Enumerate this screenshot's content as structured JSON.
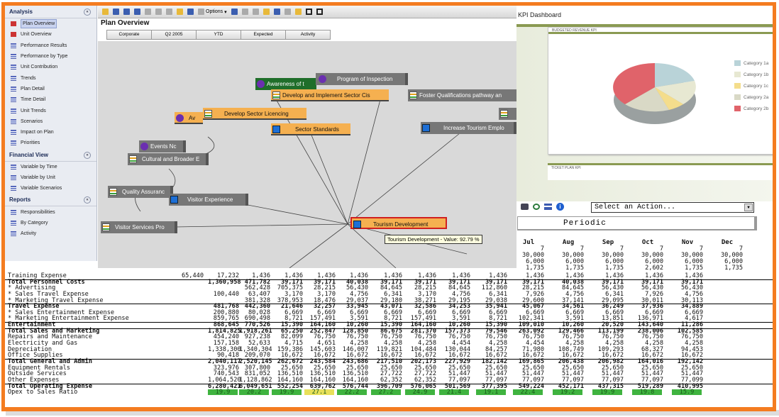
{
  "left_panel": {
    "sections": [
      {
        "title": "Analysis",
        "items": [
          "Plan Overview",
          "Unit Overview",
          "Performance Results",
          "Performance by Type",
          "Unit Contribution",
          "Trends",
          "Plan Detail",
          "Time Detail",
          "Unit Trends",
          "Scenarios",
          "Impact on Plan",
          "Priorities"
        ]
      },
      {
        "title": "Financial View",
        "items": [
          "Variable by Time",
          "Variable by Unit",
          "Variable Scenarios"
        ]
      },
      {
        "title": "Reports",
        "items": [
          "Responsibilities",
          "By Category",
          "Activity"
        ]
      }
    ]
  },
  "plan": {
    "toolbar_options": "Options",
    "title": "Plan Overview",
    "tabs": [
      "Corporate",
      "Q2 2005",
      "YTD",
      "Expected",
      "Activity"
    ],
    "nodes": {
      "awareness": "Awareness of t",
      "program": "Program of Inspection",
      "develop_implement": "Develop and Implement Sector Cis",
      "foster": "Foster Qualifications pathway an",
      "av": "Av",
      "licencing": "Develop Sector Licencing",
      "standards": "Sector Standards",
      "increase": "Increase Tourism Emplo",
      "events": "Events Nc",
      "cultural": "Cultural and Broader E",
      "quality": "Quality Assuranc",
      "visitor_exp": "Visitor Experience",
      "visitor_svc": "Visitor Services Pro",
      "tourism_dev": "Tourism Development"
    },
    "tooltip": "Tourism Development - Value: 92.79 %"
  },
  "kpi": {
    "title": "KPI Dashboard",
    "revenue_header": "BUDGETED REVENUE KPI",
    "lower_header": "TICKET PLAN KPI",
    "legend": [
      "Category 1a",
      "Category 1b",
      "Category 1c",
      "Category 2a",
      "Category 2b"
    ],
    "colors": {
      "c1a": "#b9d3d8",
      "c1b": "#e7e8d2",
      "c1c": "#f4dd8c",
      "c2a": "#d9d9c6",
      "c2b": "#e0636a"
    }
  },
  "actions": {
    "select_value": "Select an Action...",
    "periodic": "Periodic"
  },
  "table": {
    "months": [
      "Jul",
      "Aug",
      "Sep",
      "Oct",
      "Nov",
      "Dec"
    ],
    "top_rows": [
      [
        "7",
        "7",
        "7",
        "7",
        "7",
        "7"
      ],
      [
        "30,000",
        "30,000",
        "30,000",
        "30,000",
        "30,000",
        "30,000"
      ],
      [
        "6,000",
        "6,000",
        "6,000",
        "6,000",
        "6,000",
        "6,000"
      ],
      [
        "1,735",
        "1,735",
        "1,735",
        "2,602",
        "1,735",
        "1,735"
      ]
    ],
    "rows": [
      {
        "label": "Training Expense",
        "values": [
          "65,440",
          "17,232",
          "1,436",
          "1,436",
          "1,436",
          "1,436",
          "1,436",
          "1,436",
          "1,436",
          "1,436",
          "1,436",
          "1,436",
          "1,436",
          "1,436",
          "1,436"
        ]
      },
      {
        "label": "Total Personnel Costs",
        "bold": true,
        "values": [
          "1,360,958",
          "471,782",
          "39,171",
          "39,171",
          "40,038",
          "39,171",
          "39,171",
          "39,171",
          "39,171",
          "39,171",
          "40,038",
          "39,171",
          "39,171",
          "39,171"
        ]
      },
      {
        "label": "* Advertising",
        "values": [
          "562,428",
          "705,375",
          "28,215",
          "56,430",
          "84,645",
          "28,215",
          "84,645",
          "112,860",
          "28,215",
          "84,645",
          "56,430",
          "56,430",
          "56,430"
        ]
      },
      {
        "label": "* Sales Travel Expense",
        "values": [
          "100,440",
          "63,407",
          "3,170",
          "3,170",
          "4,756",
          "6,341",
          "3,170",
          "4,756",
          "6,341",
          "7,926",
          "4,756",
          "6,341",
          "7,926",
          "4,756"
        ]
      },
      {
        "label": "* Marketing Travel Expense",
        "values": [
          "381,328",
          "378,953",
          "18,476",
          "29,037",
          "29,180",
          "38,271",
          "29,195",
          "29,038",
          "29,600",
          "37,141",
          "29,095",
          "30,011",
          "30,113"
        ]
      },
      {
        "label": "Travel Expense",
        "bold": true,
        "values": [
          "481,768",
          "442,360",
          "21,646",
          "32,257",
          "33,945",
          "43,071",
          "32,586",
          "34,253",
          "35,941",
          "45,067",
          "34,561",
          "36,249",
          "37,936",
          "34,889"
        ]
      },
      {
        "label": "* Sales Entertainment Expense",
        "values": [
          "200,880",
          "80,028",
          "6,669",
          "6,669",
          "6,669",
          "6,669",
          "6,669",
          "6,669",
          "6,669",
          "6,669",
          "6,669",
          "6,669",
          "6,669",
          "6,669"
        ]
      },
      {
        "label": "* Marketing Entertainment Expense",
        "values": [
          "859,765",
          "690,498",
          "8,721",
          "157,491",
          "3,591",
          "8,721",
          "157,491",
          "3,591",
          "8,721",
          "102,341",
          "3,591",
          "13,851",
          "136,971",
          "4,617"
        ]
      },
      {
        "label": "Entertainment",
        "bold": true,
        "values": [
          "868,645",
          "770,526",
          "15,390",
          "164,160",
          "10,260",
          "15,390",
          "164,160",
          "10,260",
          "15,390",
          "109,010",
          "10,260",
          "20,520",
          "143,640",
          "11,286"
        ]
      },
      {
        "label": "Total Sales and Marketing",
        "bold": true,
        "values": [
          "1,814,825",
          "1,918,261",
          "65,250",
          "252,847",
          "128,850",
          "86,675",
          "281,370",
          "157,373",
          "79,546",
          "263,092",
          "129,466",
          "113,199",
          "238,006",
          "102,585"
        ]
      },
      {
        "label": "Repairs and Maintenance",
        "values": [
          "454,240",
          "927,238",
          "82,099",
          "76,750",
          "76,750",
          "76,750",
          "76,750",
          "76,750",
          "76,750",
          "76,750",
          "76,750",
          "76,750",
          "76,750",
          "76,750"
        ]
      },
      {
        "label": "Electricity and Gas",
        "values": [
          "157,158",
          "52,633",
          "4,715",
          "4,651",
          "4,258",
          "4,258",
          "4,258",
          "4,454",
          "4,258",
          "4,454",
          "4,258",
          "4,258",
          "4,258",
          "4,258"
        ]
      },
      {
        "label": "Depreciation",
        "values": [
          "1,338,300",
          "1,340,304",
          "159,386",
          "145,603",
          "146,007",
          "119,821",
          "104,484",
          "130,044",
          "84,257",
          "71,980",
          "108,749",
          "109,293",
          "68,327",
          "94,453"
        ]
      },
      {
        "label": "Office Supplies",
        "values": [
          "90,418",
          "209,070",
          "16,672",
          "16,672",
          "16,672",
          "16,672",
          "16,672",
          "16,672",
          "16,672",
          "16,672",
          "16,672",
          "16,672",
          "16,672",
          "16,672"
        ]
      },
      {
        "label": "Total General and Admin",
        "bold": true,
        "values": [
          "2,040,117",
          "2,520,145",
          "262,672",
          "243,584",
          "243,686",
          "217,510",
          "202,173",
          "227,929",
          "182,142",
          "169,865",
          "206,438",
          "206,982",
          "164,016",
          "192,142"
        ]
      },
      {
        "label": "Equipment Rentals",
        "values": [
          "323,976",
          "307,800",
          "25,650",
          "25,650",
          "25,650",
          "25,650",
          "25,650",
          "25,650",
          "25,650",
          "25,650",
          "25,650",
          "25,650",
          "25,650",
          "25,650"
        ]
      },
      {
        "label": "Outside Services",
        "values": [
          "740,543",
          "831,052",
          "136,510",
          "136,510",
          "136,510",
          "27,722",
          "27,722",
          "51,447",
          "51,447",
          "51,447",
          "51,447",
          "51,447",
          "51,447",
          "51,447"
        ]
      },
      {
        "label": "Other Expenses",
        "values": [
          "1,064,520",
          "1,128,862",
          "164,160",
          "164,160",
          "164,160",
          "62,352",
          "62,352",
          "77,097",
          "77,097",
          "77,097",
          "77,097",
          "77,097",
          "77,097",
          "77,099"
        ]
      },
      {
        "label": "Total Operating Expense",
        "bold": true,
        "values": [
          "6,280,421",
          "6,049,651",
          "552,254",
          "639,762",
          "576,744",
          "396,709",
          "576,065",
          "501,569",
          "377,395",
          "549,224",
          "452,171",
          "437,315",
          "519,289",
          "410,995"
        ]
      },
      {
        "label": "Opex to Sales Ratio",
        "ratio": true,
        "values": [
          "19.9",
          "20.2",
          "19.9",
          "27.1",
          "22.2",
          "27.2",
          "24.9",
          "21.4",
          "19.1",
          "22.4",
          "19.2",
          "19.9",
          "19.8",
          "15.9"
        ]
      }
    ]
  }
}
